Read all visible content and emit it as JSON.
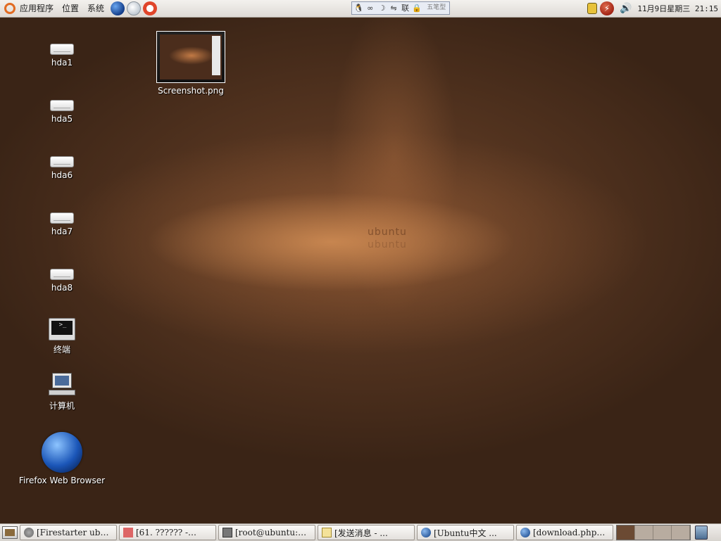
{
  "top_panel": {
    "menus": [
      "应用程序",
      "位置",
      "系统"
    ],
    "launchers": [
      "globe-launcher-icon",
      "mail-launcher-icon",
      "help-launcher-icon"
    ],
    "input_method": {
      "icons": [
        "penguin-icon",
        "link-icon",
        "moon-icon",
        "switch-icon",
        "联",
        "lock-icon"
      ],
      "mode_label": "五笔型"
    },
    "clock": "11月9日星期三 21:15"
  },
  "desktop": {
    "logo_text": "ubuntu",
    "icons": [
      {
        "label": "hda1",
        "icon": "drive-icon"
      },
      {
        "label": "hda5",
        "icon": "drive-icon"
      },
      {
        "label": "hda6",
        "icon": "drive-icon"
      },
      {
        "label": "hda7",
        "icon": "drive-icon"
      },
      {
        "label": "hda8",
        "icon": "drive-icon"
      },
      {
        "label": "终端",
        "icon": "terminal-icon"
      },
      {
        "label": "计算机",
        "icon": "computer-icon"
      },
      {
        "label": "Firefox Web Browser",
        "icon": "firefox-icon"
      },
      {
        "label": "Screenshot.png",
        "icon": "image-thumbnail-icon"
      }
    ]
  },
  "taskbar": {
    "tasks": [
      {
        "label": "[Firestarter ub…",
        "icon": "firestarter-icon"
      },
      {
        "label": "[61. ?????? -…",
        "icon": "gaim-icon"
      },
      {
        "label": "[root@ubuntu:…",
        "icon": "terminal-icon"
      },
      {
        "label": "[发送消息 - ...",
        "icon": "note-icon"
      },
      {
        "label": "[Ubuntu中文 ...",
        "icon": "globe-icon"
      },
      {
        "label": "[download.php…",
        "icon": "globe-icon"
      }
    ],
    "workspaces": 4,
    "active_workspace": 1
  },
  "colors": {
    "panel": "#e8e5e1",
    "wallpaper_dark": "#3a2416",
    "wallpaper_glow": "#dc965a",
    "accent_orange": "#e16b22"
  }
}
